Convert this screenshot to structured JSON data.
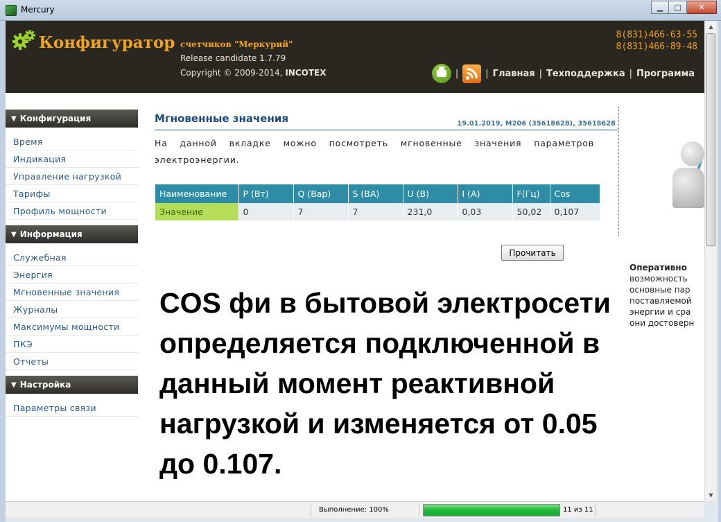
{
  "window": {
    "title": "Mercury",
    "minimize": "▁",
    "maximize": "□",
    "close": "✕"
  },
  "header": {
    "brand": "Конфигуратор",
    "subtitle": "счетчиков \"Меркурий\"",
    "release": "Release candidate 1.7.79",
    "copyright_prefix": "Copyright © 2009-2014, ",
    "copyright_company": "INCOTEX",
    "phone1": "8(831)466-63-55",
    "phone2": "8(831)466-89-48",
    "nav": [
      "Главная",
      "Техподдержка",
      "Программа"
    ]
  },
  "sidebar": {
    "sections": [
      {
        "label": "Конфигурация",
        "items": [
          "Время",
          "Индикация",
          "Управление нагрузкой",
          "Тарифы",
          "Профиль мощности"
        ]
      },
      {
        "label": "Информация",
        "items": [
          "Служебная",
          "Энергия",
          "Мгновенные значения",
          "Журналы",
          "Максимумы мощности",
          "ПКЭ",
          "Отчеты"
        ]
      },
      {
        "label": "Настройка",
        "items": [
          "Параметры связи"
        ]
      }
    ]
  },
  "main": {
    "title": "Мгновенные значения",
    "meta": "19.01.2019, M206 (35618628), 35618628",
    "description": "На данной вкладке можно посмотреть мгновенные значения параметров электроэнергии.",
    "table": {
      "headers": [
        "Наименование",
        "P (Вт)",
        "Q (Вар)",
        "S (ВА)",
        "U (В)",
        "I (А)",
        "F(Гц)",
        "Cos"
      ],
      "row": [
        "Значение",
        "0",
        "7",
        "7",
        "231,0",
        "0,03",
        "50,02",
        "0,107"
      ]
    },
    "read_button": "Прочитать"
  },
  "right_panel": {
    "lines": [
      "Оперативно",
      "возможность",
      "основные пар",
      "поставляемой",
      "энергии и сра",
      "они достоверн"
    ]
  },
  "overlay_caption": "COS фи в бытовой электросети определяется подключенной в данный момент реактивной нагрузкой и изменяется от 0.05 до 0.107.",
  "status": {
    "label": "Выполнение: 100%",
    "progress_fraction": 1.0,
    "count": "11 из 11"
  }
}
